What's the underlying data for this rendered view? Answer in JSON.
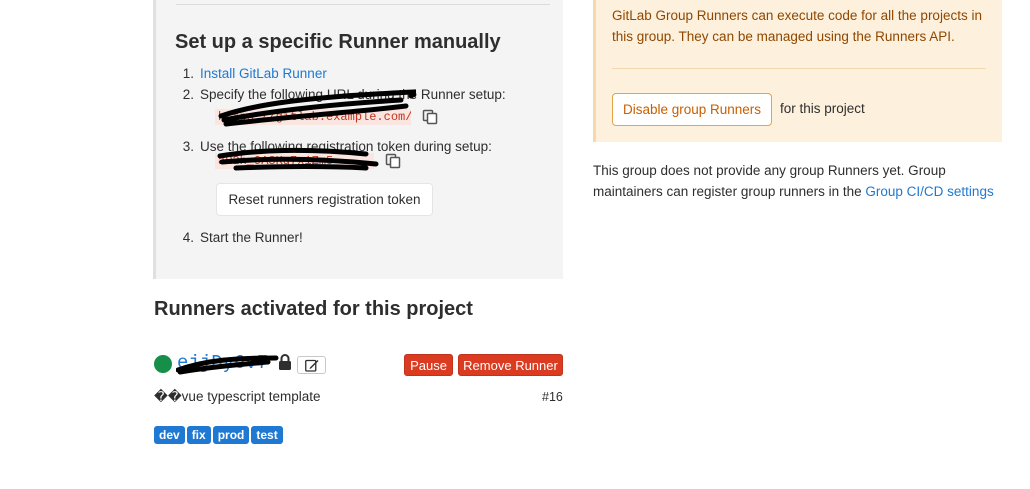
{
  "setup": {
    "title": "Set up a specific Runner manually",
    "steps": {
      "s1_num": "1.",
      "s1_link": "Install GitLab Runner",
      "s2_num": "2.",
      "s2_text": "Specify the following URL during the Runner setup:",
      "s2_code": "https://gitlab.example.com/",
      "s3_num": "3.",
      "s3_text": "Use the following registration token during setup:",
      "s3_code": "aR2h_9A3Kq7x1Zm5",
      "s4_num": "4.",
      "s4_text": "Start the Runner!"
    },
    "reset_button": "Reset runners registration token"
  },
  "runners": {
    "title": "Runners activated for this project",
    "runner": {
      "token": "ejjDy6v7",
      "status_color": "#168f48",
      "pause_label": "Pause",
      "remove_label": "Remove Runner",
      "description": "��vue typescript template",
      "id": "#16",
      "tags": [
        "dev",
        "fix",
        "prod",
        "test"
      ]
    }
  },
  "group": {
    "info": "GitLab Group Runners can execute code for all the projects in this group. They can be managed using the Runners API.",
    "disable_button": "Disable group Runners",
    "for_project": "for this project",
    "note_text": "This group does not provide any group Runners yet. Group maintainers can register group runners in the ",
    "note_link": "Group CI/CD settings"
  },
  "colors": {
    "link": "#1f78d1",
    "danger": "#db3b21",
    "warning_bg": "#fdf1dd",
    "warning_text": "#8f4700"
  },
  "icons": {
    "copy": "clipboard-icon",
    "lock": "lock-icon",
    "edit": "pencil-icon"
  }
}
